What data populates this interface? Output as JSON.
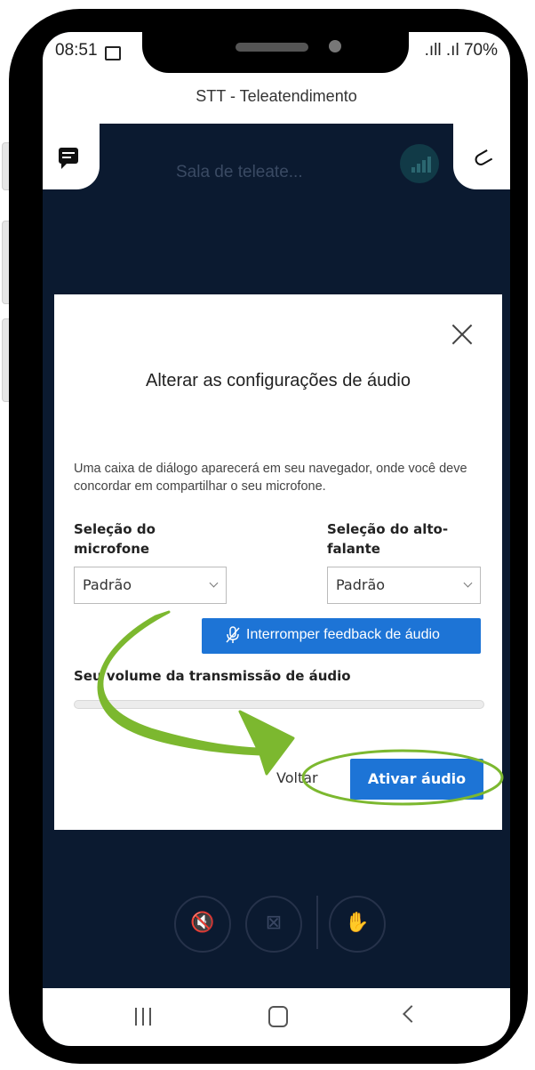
{
  "status": {
    "time": "08:51",
    "right": ".ıll .ıl 70%"
  },
  "app": {
    "title": "STT - Teleatendimento"
  },
  "room": {
    "title": "Sala de teleate..."
  },
  "dialog": {
    "title": "Alterar as configurações de áudio",
    "description": "Uma caixa de diálogo aparecerá em seu navegador, onde você deve concordar em compartilhar o seu microfone.",
    "mic_label_1": "Seleção do",
    "mic_label_2": "microfone",
    "speaker_label_1": "Seleção do alto-",
    "speaker_label_2": "falante",
    "mic_select_value": "Padrão",
    "speaker_select_value": "Padrão",
    "feedback_button": "Interromper feedback de áudio",
    "volume_label": "Seu volume da transmissão de áudio",
    "volume_level": 0,
    "back_button": "Voltar",
    "activate_button": "Ativar áudio"
  },
  "colors": {
    "accent": "#1d74d6",
    "background": "#0b1a30",
    "annotation": "#7cb82f"
  },
  "icons": [
    "chat-icon",
    "paperclip-icon",
    "signal-icon",
    "close-icon",
    "mic-off-icon",
    "speaker-mute-icon",
    "camera-off-icon",
    "raise-hand-icon"
  ]
}
